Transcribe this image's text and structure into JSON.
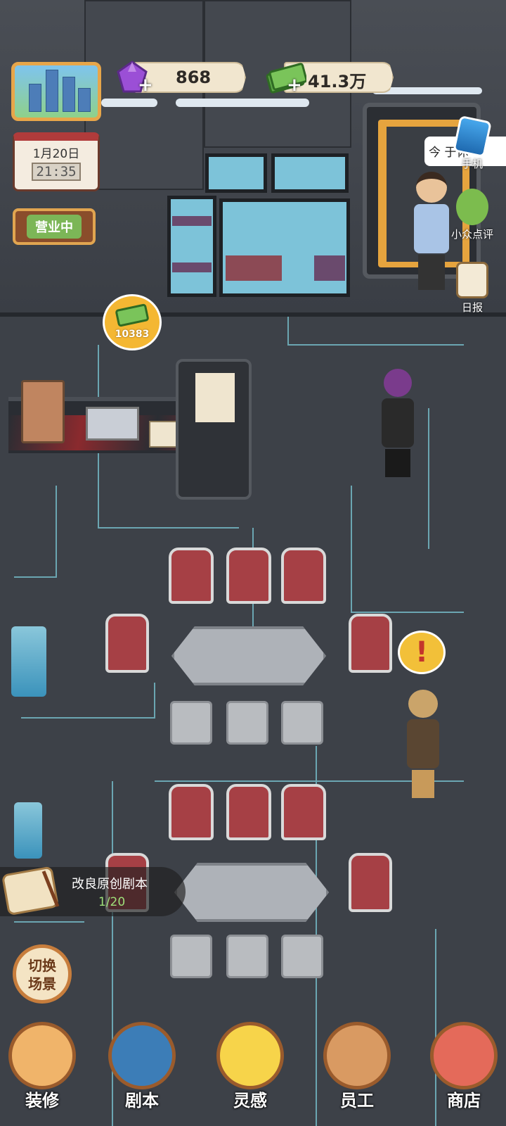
{
  "hud": {
    "gems": "868",
    "cash": "41.3万",
    "date": "1月20日",
    "time": "21:35",
    "status": "营业中"
  },
  "side_menu": {
    "phone_label": "手机",
    "review_label": "小众点评",
    "daily_label": "日报",
    "bubble_text": "今 于休"
  },
  "coin_bubble": {
    "amount": "10383"
  },
  "task": {
    "title": "改良原创剧本",
    "progress": "1/20"
  },
  "switch_scene": {
    "line1": "切换",
    "line2": "场景"
  },
  "bottom_nav": [
    {
      "label": "装修",
      "icon": "house-icon"
    },
    {
      "label": "剧本",
      "icon": "script-book-icon"
    },
    {
      "label": "灵感",
      "icon": "lightbulb-icon"
    },
    {
      "label": "员工",
      "icon": "staff-badge-icon"
    },
    {
      "label": "商店",
      "icon": "shop-icon"
    }
  ],
  "icons": {
    "gem": "gem-icon",
    "cash": "cash-icon",
    "alert": "exclamation-icon"
  },
  "colors": {
    "hud_frame": "#e7a64a",
    "open_green": "#7cb657",
    "coin_yellow": "#f4b733",
    "chair_red": "#a64045",
    "nav_ring": "#9a5b2c"
  }
}
